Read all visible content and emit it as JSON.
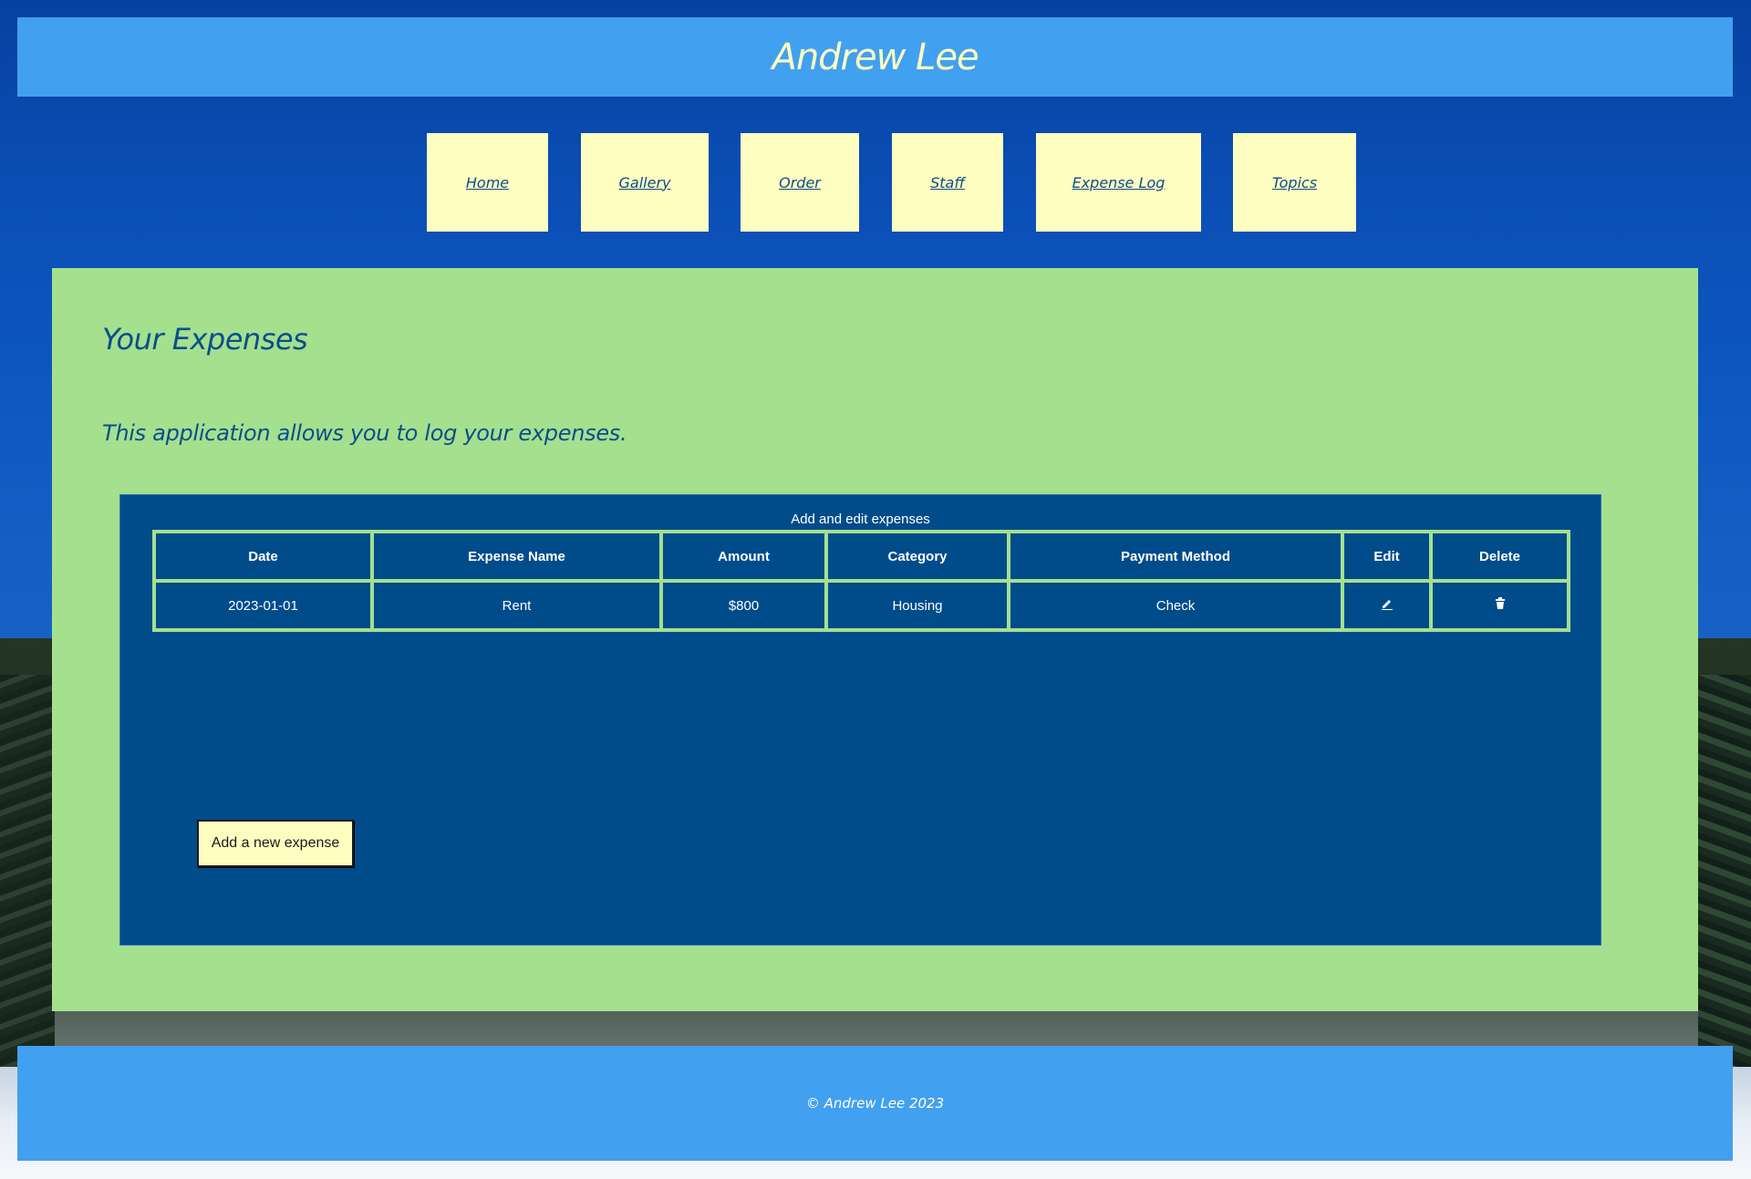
{
  "site": {
    "title": "Andrew Lee"
  },
  "nav": {
    "items": [
      {
        "label": "Home"
      },
      {
        "label": "Gallery"
      },
      {
        "label": "Order"
      },
      {
        "label": "Staff"
      },
      {
        "label": "Expense Log"
      },
      {
        "label": "Topics"
      }
    ]
  },
  "main": {
    "title": "Your Expenses",
    "description": "This application allows you to log your expenses.",
    "table": {
      "caption": "Add and edit expenses",
      "headers": [
        "Date",
        "Expense Name",
        "Amount",
        "Category",
        "Payment Method",
        "Edit",
        "Delete"
      ],
      "rows": [
        {
          "date": "2023-01-01",
          "name": "Rent",
          "amount": "$800",
          "category": "Housing",
          "payment": "Check",
          "edit_icon": "pencil-icon",
          "delete_icon": "trash-icon"
        }
      ]
    },
    "add_button_label": "Add a new expense"
  },
  "footer": {
    "text": "© Andrew Lee 2023"
  },
  "colors": {
    "header_bg": "#42a0f0",
    "nav_bg": "#fffec1",
    "main_bg": "#a4e08e",
    "panel_bg": "#004c8b",
    "heading_text": "#0c4d8c"
  }
}
